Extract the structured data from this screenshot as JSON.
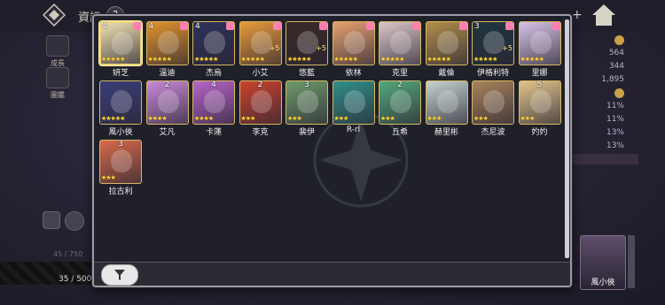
{
  "top": {
    "title": "資訊",
    "badge": "?"
  },
  "sidebar": {
    "items": [
      {
        "label": "成長"
      },
      {
        "label": "圖鑑"
      }
    ]
  },
  "right_stats": {
    "values": [
      "564",
      "344",
      "1,895",
      "11%",
      "11%",
      "13%",
      "13%"
    ]
  },
  "bottom": {
    "count": "35 / 500",
    "faint": "45 / 750"
  },
  "side_hero": {
    "name": "風小俠"
  },
  "colors": {
    "panel_bg": "#1f2029",
    "panel_border": "#9a9aa4",
    "star": "#ffd53a",
    "frame": "#d7b860"
  },
  "cards": [
    {
      "name": "妍芝",
      "level": "4",
      "level_pos": "corner",
      "gift": true,
      "stars": "★★★★★",
      "selected": true,
      "color": "#efe0b0"
    },
    {
      "name": "溫迪",
      "level": "4",
      "level_pos": "corner",
      "gift": true,
      "stars": "★★★★★",
      "color": "#e0932c"
    },
    {
      "name": "杰烏",
      "level": "4",
      "level_pos": "corner",
      "gift": true,
      "stars": "★★★★★",
      "color": "#2e3258"
    },
    {
      "name": "小艾",
      "level": "",
      "level_pos": "corner",
      "gift": true,
      "plus": "+5",
      "stars": "★★★★★",
      "color": "#e89a3a"
    },
    {
      "name": "悠藍",
      "level": "",
      "level_pos": "corner",
      "gift": true,
      "plus": "+5",
      "stars": "★★★★★",
      "color": "#3a2a26"
    },
    {
      "name": "依林",
      "level": "",
      "level_pos": "corner",
      "gift": true,
      "stars": "★★★★★",
      "color": "#e6a070"
    },
    {
      "name": "克里",
      "level": "",
      "level_pos": "corner",
      "gift": true,
      "stars": "★★★★★",
      "color": "#d9c7c7"
    },
    {
      "name": "戴倫",
      "level": "",
      "level_pos": "corner",
      "gift": true,
      "stars": "★★★★★",
      "color": "#b08e4a"
    },
    {
      "name": "伊格利特",
      "level": "3",
      "level_pos": "corner",
      "gift": true,
      "plus": "+5",
      "stars": "★★★★★",
      "color": "#1f3640"
    },
    {
      "name": "里娜",
      "level": "",
      "level_pos": "corner",
      "gift": true,
      "stars": "★★★★★",
      "color": "#d7c2e6"
    },
    {
      "name": "風小俠",
      "level": "",
      "level_pos": "corner",
      "gift": false,
      "stars": "★★★★★",
      "color": "#3a3e78"
    },
    {
      "name": "艾凡",
      "level": "2",
      "level_pos": "top",
      "gift": false,
      "stars": "★★★★",
      "color": "#c98ad9"
    },
    {
      "name": "卡蓮",
      "level": "4",
      "level_pos": "top",
      "gift": false,
      "stars": "★★★★",
      "color": "#b765c9"
    },
    {
      "name": "李克",
      "level": "2",
      "level_pos": "top",
      "gift": false,
      "stars": "★★★",
      "color": "#c9432f"
    },
    {
      "name": "裴伊",
      "level": "3",
      "level_pos": "top",
      "gift": false,
      "stars": "★★★",
      "color": "#6f9a6a"
    },
    {
      "name": "R-rl",
      "level": "",
      "level_pos": "top",
      "gift": false,
      "stars": "★★★",
      "color": "#2f8f8a"
    },
    {
      "name": "丘希",
      "level": "2",
      "level_pos": "top",
      "gift": false,
      "stars": "★★★",
      "color": "#53a87a"
    },
    {
      "name": "赫里彬",
      "level": "",
      "level_pos": "top",
      "gift": false,
      "stars": "★★★",
      "color": "#c4d4cf"
    },
    {
      "name": "杰尼波",
      "level": "",
      "level_pos": "top",
      "gift": false,
      "stars": "★★★",
      "color": "#a8825c"
    },
    {
      "name": "妁妁",
      "level": "5",
      "level_pos": "top",
      "gift": false,
      "stars": "★★★",
      "color": "#e2c48a"
    },
    {
      "name": "拉古利",
      "level": "3",
      "level_pos": "top",
      "gift": false,
      "stars": "★★★",
      "color": "#d86a4a"
    }
  ]
}
